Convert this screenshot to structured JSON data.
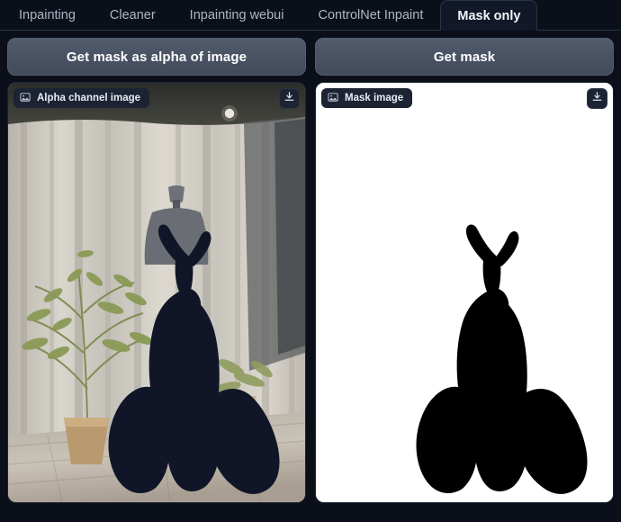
{
  "tabs": [
    {
      "label": "Inpainting",
      "active": false
    },
    {
      "label": "Cleaner",
      "active": false
    },
    {
      "label": "Inpainting webui",
      "active": false
    },
    {
      "label": "ControlNet Inpaint",
      "active": false
    },
    {
      "label": "Mask only",
      "active": true
    }
  ],
  "left": {
    "button_label": "Get mask as alpha of image",
    "panel_label": "Alpha channel image",
    "label_icon": "image-icon",
    "download_icon": "download-icon",
    "image_description": "Photo of a mannequin wearing a dark gown with a ruffled skirt in a room with white curtains, a green potted plant and wooden floor; the gown area is filled with flat dark navy alpha fill"
  },
  "right": {
    "button_label": "Get mask",
    "panel_label": "Mask image",
    "label_icon": "image-icon",
    "download_icon": "download-icon",
    "image_description": "Black silhouette mask of the gown with shoulder straps and a wide ruffled skirt on a white background"
  },
  "colors": {
    "page_background": "#0b0f19",
    "tab_active_background": "#111827",
    "tab_inactive_text": "#aeb6c4",
    "tab_active_text": "#f4f6fa",
    "button_background": "#4a5364",
    "button_text": "#ffffff",
    "badge_background": "#1c2333",
    "mask_fill": "#000000",
    "mask_background": "#ffffff",
    "alpha_fill": "#101628"
  }
}
